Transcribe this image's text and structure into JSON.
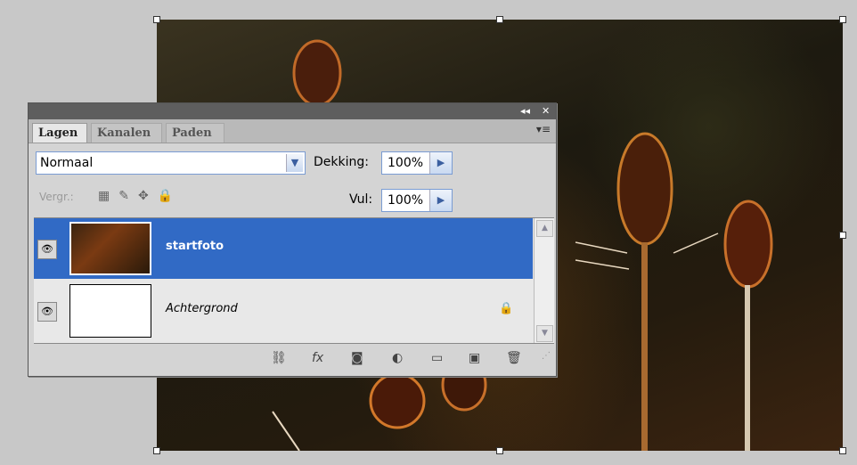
{
  "panel": {
    "title_controls": {
      "collapse": "◂◂",
      "close": "✕"
    },
    "tabs": [
      {
        "label": "Lagen"
      },
      {
        "label": "Kanalen"
      },
      {
        "label": "Paden"
      }
    ],
    "menu_icon": "panel-menu-icon",
    "blend_mode": "Normaal",
    "opacity_label": "Dekking:",
    "opacity_value": "100%",
    "lock_label": "Vergr.:",
    "fill_label": "Vul:",
    "fill_value": "100%",
    "layers": [
      {
        "name": "startfoto",
        "selected": true
      },
      {
        "name": "Achtergrond",
        "selected": false,
        "locked": true
      }
    ],
    "bottom_icons": [
      "link-icon",
      "fx-icon",
      "mask-icon",
      "adjustment-icon",
      "group-folder-icon",
      "new-layer-icon",
      "trash-icon"
    ]
  },
  "colors": {
    "selection": "#316ac5",
    "panel_bg": "#d4d4d4",
    "titlebar": "#5e5e5e"
  }
}
